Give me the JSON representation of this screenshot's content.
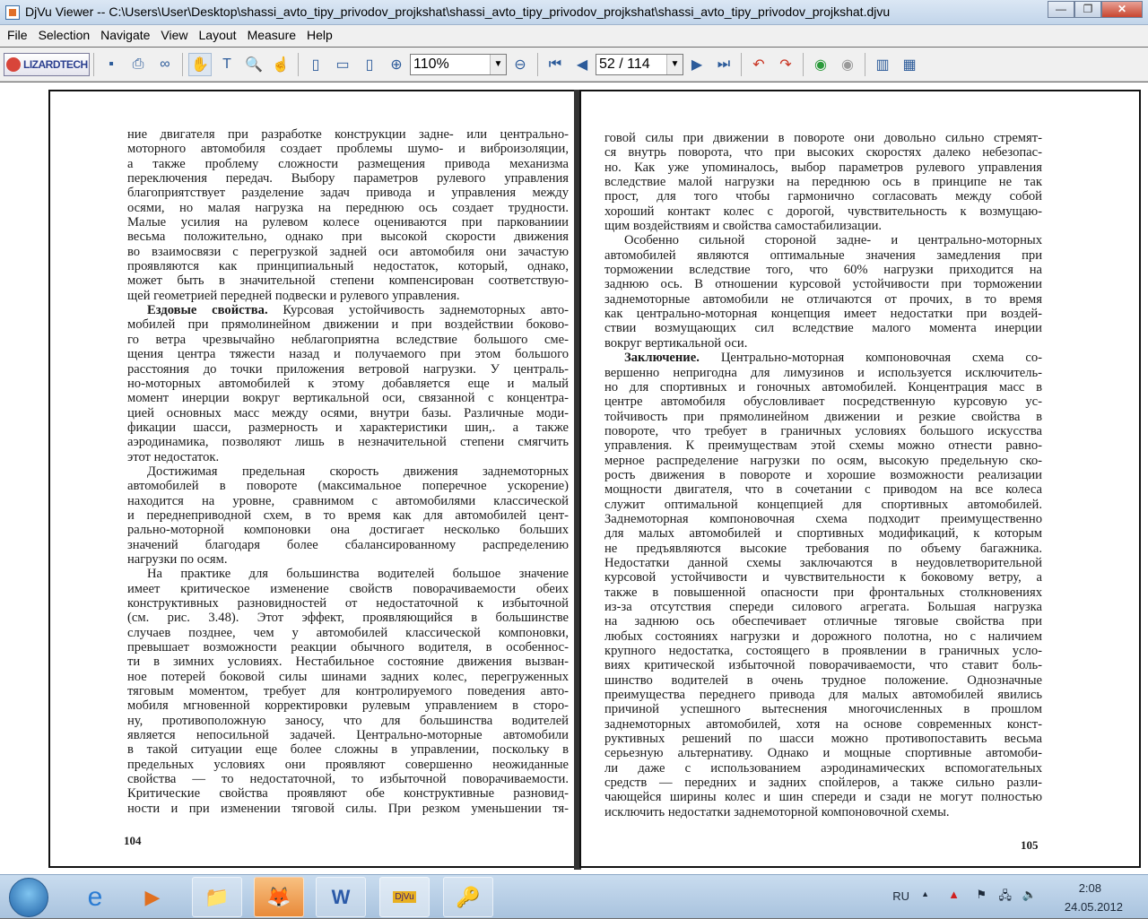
{
  "window": {
    "title": "DjVu Viewer -- C:\\Users\\User\\Desktop\\shassi_avto_tipy_privodov_projkshat\\shassi_avto_tipy_privodov_projkshat\\shassi_avto_tipy_privodov_projkshat.djvu",
    "minimize": "—",
    "maximize": "❐",
    "close": "✕"
  },
  "menu": [
    "File",
    "Selection",
    "Navigate",
    "View",
    "Layout",
    "Measure",
    "Help"
  ],
  "toolbar": {
    "logo": "LIZARDTECH",
    "zoom": "110%",
    "page": "52 / 114"
  },
  "pages": {
    "left": {
      "number": "104",
      "lines": [
        {
          "t": "ние двигателя при разработке конструкции задне- или центрально-"
        },
        {
          "t": "моторного автомобиля создает проблемы шумо- и виброизоляции,"
        },
        {
          "t": "а также проблему сложности размещения привода механизма"
        },
        {
          "t": "переключения передач. Выбору параметров рулевого управления"
        },
        {
          "t": "благоприятствует разделение задач привода и управления между"
        },
        {
          "t": "осями, но малая нагрузка на переднюю ось создает трудности."
        },
        {
          "t": "Малые усилия на рулевом колесе оцениваются при паркованиии"
        },
        {
          "t": "весьма положительно, однако при высокой скорости движения"
        },
        {
          "t": "во взаимосвязи с перегрузкой задней оси автомобиля они зачастую"
        },
        {
          "t": "проявляются как принципиальный недостаток, который, однако,"
        },
        {
          "t": "может быть в значительной степени компенсирован соответствую-"
        },
        {
          "t": "щей геометрией передней подвески и рулевого управления.",
          "end": true
        },
        {
          "b": "Ездовые свойства.",
          "t": " Курсовая устойчивость заднемоторных авто-",
          "ind": true
        },
        {
          "t": "мобилей при прямолинейном движении и при воздействии боково-"
        },
        {
          "t": "го ветра чрезвычайно неблагоприятна вследствие большого сме-"
        },
        {
          "t": "щения центра тяжести назад и получаемого при этом большого"
        },
        {
          "t": "расстояния до точки приложения ветровой нагрузки. У централь-"
        },
        {
          "t": "но-моторных автомобилей к этому добавляется еще и малый"
        },
        {
          "t": "момент инерции вокруг вертикальной оси, связанной с концентра-"
        },
        {
          "t": "цией основных масс между осями, внутри базы. Различные моди-"
        },
        {
          "t": "фикации шасси, размерность и характеристики шин,. а также"
        },
        {
          "t": "аэродинамика, позволяют лишь в незначительной степени смягчить"
        },
        {
          "t": "этот недостаток.",
          "end": true
        },
        {
          "t": "Достижимая предельная скорость движения заднемоторных",
          "ind": true
        },
        {
          "t": "автомобилей в повороте (максимальное поперечное ускорение)"
        },
        {
          "t": "находится на уровне, сравнимом с автомобилями классической"
        },
        {
          "t": "и переднеприводной схем, в то время как для автомобилей цент-"
        },
        {
          "t": "рально-моторной компоновки она достигает несколько больших"
        },
        {
          "t": "значений благодаря более сбалансированному распределению"
        },
        {
          "t": "нагрузки по осям.",
          "end": true
        },
        {
          "t": "На практике для большинства водителей большое значение",
          "ind": true
        },
        {
          "t": "имеет критическое изменение свойств поворачиваемости обеих"
        },
        {
          "t": "конструктивных разновидностей от недостаточной к избыточной"
        },
        {
          "t": "(см. рис. 3.48). Этот эффект, проявляющийся в большинстве"
        },
        {
          "t": "случаев позднее, чем у автомобилей классической компоновки,"
        },
        {
          "t": "превышает возможности реакции обычного водителя, в особеннос-"
        },
        {
          "t": "ти в зимних условиях. Нестабильное состояние движения вызван-"
        },
        {
          "t": "ное потерей боковой силы шинами задних колес, перегруженных"
        },
        {
          "t": "тяговым моментом, требует для контролируемого поведения авто-"
        },
        {
          "t": "мобиля мгновенной корректировки рулевым управлением в сторо-"
        },
        {
          "t": "ну, противоположную заносу, что для большинства водителей"
        },
        {
          "t": "является непосильной задачей. Центрально-моторные автомобили"
        },
        {
          "t": "в такой ситуации еще более сложны в управлении, поскольку в"
        },
        {
          "t": "предельных условиях они проявляют совершенно неожиданные"
        },
        {
          "t": "свойства — то недостаточной, то избыточной поворачиваемости."
        },
        {
          "t": "Критические свойства проявляют обе конструктивные разновид-"
        },
        {
          "t": "ности и при изменении тяговой силы. При резком уменьшении тя-"
        }
      ]
    },
    "right": {
      "number": "105",
      "lines": [
        {
          "t": "говой силы при движении в повороте они довольно сильно стремят-"
        },
        {
          "t": "ся внутрь поворота, что при высоких скоростях далеко небезопас-"
        },
        {
          "t": "но. Как уже упоминалось, выбор параметров рулевого управления"
        },
        {
          "t": "вследствие малой нагрузки на переднюю ось в принципе не так"
        },
        {
          "t": "прост, для того чтобы гармонично согласовать между собой"
        },
        {
          "t": "хороший контакт колес с дорогой, чувствительность к возмущаю-"
        },
        {
          "t": "щим воздействиям и свойства самостабилизации.",
          "end": true
        },
        {
          "t": "Особенно сильной стороной задне- и центрально-моторных",
          "ind": true
        },
        {
          "t": "автомобилей являются оптимальные значения замедления при"
        },
        {
          "t": "торможении вследствие того, что 60% нагрузки приходится на"
        },
        {
          "t": "заднюю ось. В отношении курсовой устойчивости при торможении"
        },
        {
          "t": "заднемоторные автомобили не отличаются от прочих, в то время"
        },
        {
          "t": "как центрально-моторная концепция имеет недостатки при воздей-"
        },
        {
          "t": "ствии возмущающих сил вследствие малого момента инерции"
        },
        {
          "t": "вокруг вертикальной оси.",
          "end": true
        },
        {
          "b": "Заключение.",
          "t": " Центрально-моторная компоновочная схема со-",
          "ind": true
        },
        {
          "t": "вершенно непригодна для лимузинов и используется исключитель-"
        },
        {
          "t": "но для спортивных и гоночных автомобилей. Концентрация масс в"
        },
        {
          "t": "центре автомобиля обусловливает посредственную курсовую ус-"
        },
        {
          "t": "тойчивость при прямолинейном движении и резкие свойства в"
        },
        {
          "t": "повороте, что требует в граничных условиях большого искусства"
        },
        {
          "t": "управления. К преимуществам этой схемы можно отнести равно-"
        },
        {
          "t": "мерное распределение нагрузки по осям, высокую предельную ско-"
        },
        {
          "t": "рость движения в повороте и хорошие возможности реализации"
        },
        {
          "t": "мощности двигателя, что в сочетании с приводом на все колеса"
        },
        {
          "t": "служит оптимальной концепцией для спортивных автомобилей."
        },
        {
          "t": "Заднемоторная компоновочная схема подходит преимущественно"
        },
        {
          "t": "для малых автомобилей и спортивных модификаций, к которым"
        },
        {
          "t": "не предъявляются высокие требования по объему багажника."
        },
        {
          "t": "Недостатки данной схемы заключаются в неудовлетворительной"
        },
        {
          "t": "курсовой устойчивости и чувствительности к боковому ветру, а"
        },
        {
          "t": "также в повышенной опасности при фронтальных столкновениях"
        },
        {
          "t": "из-за отсутствия спереди силового агрегата. Большая нагрузка"
        },
        {
          "t": "на заднюю ось обеспечивает отличные тяговые свойства при"
        },
        {
          "t": "любых состояниях нагрузки и дорожного полотна, но с наличием"
        },
        {
          "t": "крупного недостатка, состоящего в проявлении в граничных усло-"
        },
        {
          "t": "виях критической избыточной поворачиваемости, что ставит боль-"
        },
        {
          "t": "шинство водителей в очень трудное положение. Однозначные"
        },
        {
          "t": "преимущества переднего привода для малых автомобилей явились"
        },
        {
          "t": "причиной успешного вытеснения многочисленных в прошлом"
        },
        {
          "t": "заднемоторных автомобилей, хотя на основе современных конст-"
        },
        {
          "t": "руктивных решений по шасси можно противопоставить весьма"
        },
        {
          "t": "серьезную альтернативу. Однако и мощные спортивные автомоби-"
        },
        {
          "t": "ли даже с использованием аэродинамических вспомогательных"
        },
        {
          "t": "средств — передних и задних спойлеров, а также сильно разли-"
        },
        {
          "t": "чающейся ширины колес и шин спереди и сзади не могут полностью"
        },
        {
          "t": "исключить недостатки заднемоторной компоновочной схемы.",
          "end": true
        }
      ]
    }
  },
  "taskbar": {
    "lang": "RU",
    "time": "2:08",
    "date": "24.05.2012",
    "djvu_label": "DjVu"
  }
}
